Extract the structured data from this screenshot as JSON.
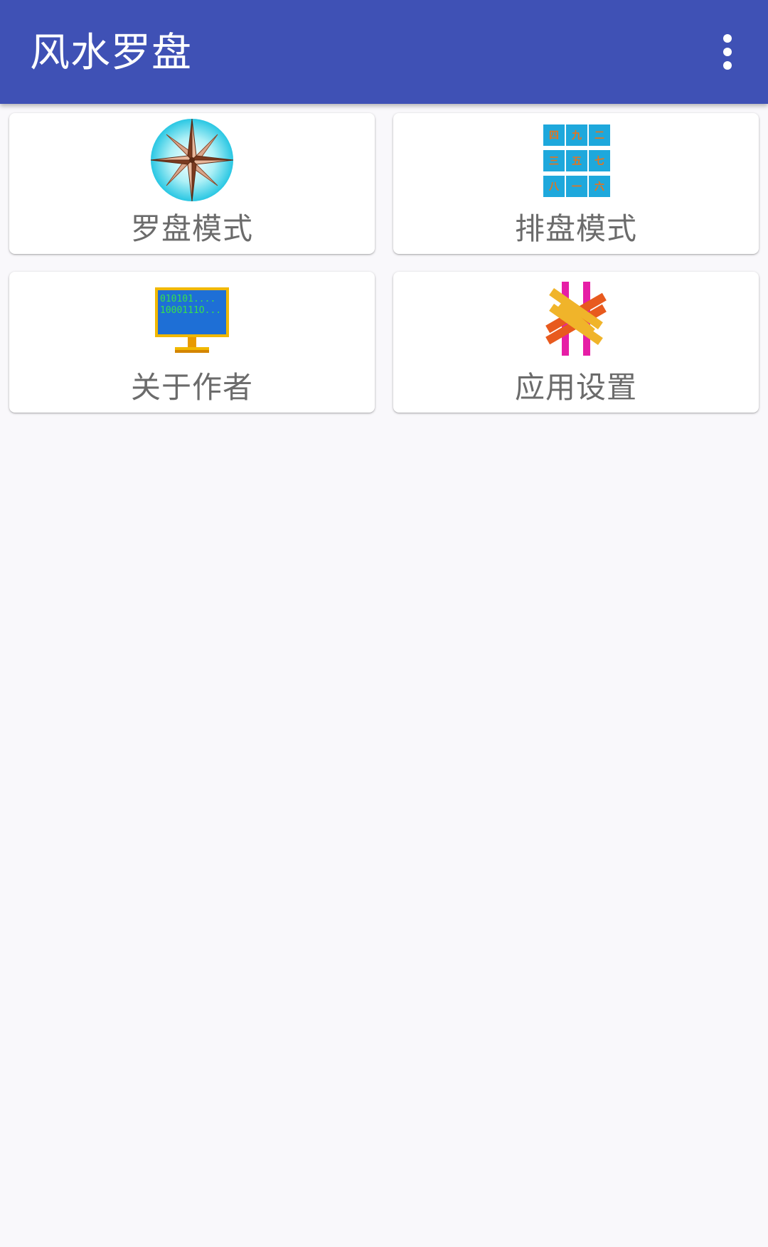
{
  "appbar": {
    "title": "风水罗盘",
    "menu_icon": "more-vert-icon",
    "color": "#3f51b5"
  },
  "menu": {
    "items": [
      {
        "label": "罗盘模式",
        "icon": "compass-rose-icon"
      },
      {
        "label": "排盘模式",
        "icon": "nine-grid-chart-icon"
      },
      {
        "label": "关于作者",
        "icon": "computer-monitor-icon"
      },
      {
        "label": "应用设置",
        "icon": "crossed-tools-settings-icon"
      }
    ],
    "grid_labels": [
      "四",
      "九",
      "二",
      "三",
      "五",
      "七",
      "八",
      "一",
      "六"
    ],
    "monitor_lines": [
      "010101....",
      "1000111O..."
    ]
  }
}
